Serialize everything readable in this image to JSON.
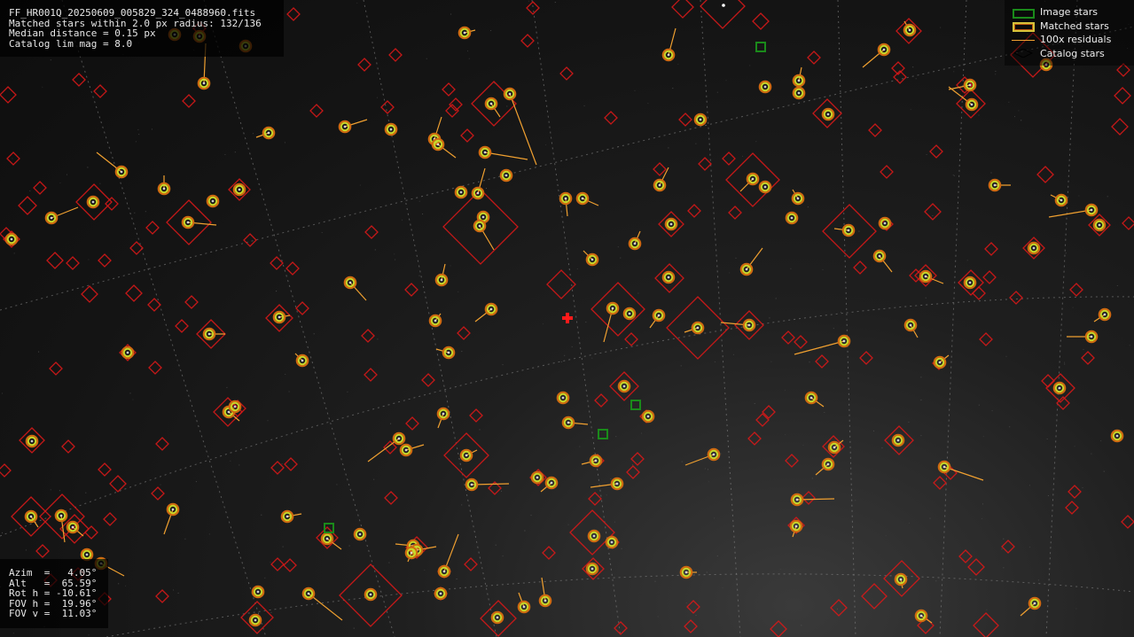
{
  "info_top": {
    "filename": "FF_HR001Q_20250609_005829_324_0488960.fits",
    "matched": "Matched stars within 2.0 px radius: 132/136",
    "median": "Median distance = 0.15 px",
    "catalog": "Catalog lim mag = 8.0"
  },
  "info_bottom": {
    "azim": "Azim  =   4.05°",
    "alt": "Alt   =  65.59°",
    "rot": "Rot h = -10.61°",
    "fovh": "FOV h =  19.96°",
    "fovv": "FOV v =  11.03°"
  },
  "legend": {
    "image_stars": "Image stars",
    "matched_stars": "Matched stars",
    "residuals": "100x residuals",
    "catalog_stars": "Catalog stars"
  },
  "colors": {
    "catalog": "#d81818",
    "matched_ring_inner": "#c8d82a",
    "matched_ring_outer": "#d06a10",
    "residual": "#f0a030",
    "image_star": "#1a8a1a",
    "centre_cross": "#ff1a1a",
    "grid": "#8a8a8a"
  },
  "icons": {
    "centre_marker": "plus-cross-icon"
  }
}
